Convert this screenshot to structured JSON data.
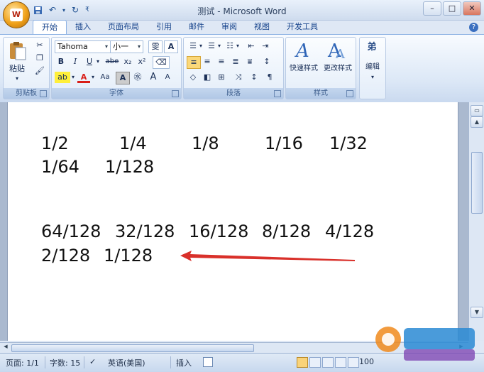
{
  "window": {
    "title": "测试 - Microsoft Word",
    "controls": [
      "–",
      "□",
      "✕"
    ]
  },
  "qat": {
    "save_icon": "save-icon",
    "undo_icon": "undo-icon",
    "redo_icon": "redo-icon"
  },
  "tabs": [
    "开始",
    "插入",
    "页面布局",
    "引用",
    "邮件",
    "审阅",
    "视图",
    "开发工具"
  ],
  "ribbon": {
    "clipboard": {
      "paste_label": "粘贴",
      "group_label": "剪贴板"
    },
    "font": {
      "font_name": "Tahoma",
      "font_size": "小一",
      "wen_label": "雯",
      "group_label": "字体",
      "bold": "B",
      "italic": "I",
      "underline": "U",
      "strike": "abe",
      "subscript": "x₂",
      "superscript": "x²",
      "grow": "A",
      "shrink": "A",
      "case": "Aa"
    },
    "paragraph": {
      "group_label": "段落"
    },
    "styles": {
      "quick_label": "快速样式",
      "change_label": "更改样式",
      "group_label": "样式"
    },
    "editing": {
      "label": "编辑",
      "find_icon_text": "弟"
    }
  },
  "document": {
    "lines": [
      [
        "1/2",
        "1/4",
        "1/8",
        "1/16",
        "1/32"
      ],
      [
        "1/64",
        "1/128"
      ],
      [
        "64/128",
        "32/128",
        "16/128",
        "8/128",
        "4/128"
      ],
      [
        "2/128",
        "1/128"
      ]
    ]
  },
  "status": {
    "page": "页面: 1/1",
    "words": "字数: 15",
    "language": "英语(美国)",
    "insert": "插入",
    "zoom": "100"
  },
  "colors": {
    "accent": "#15428b",
    "arrow": "#d9302a"
  }
}
